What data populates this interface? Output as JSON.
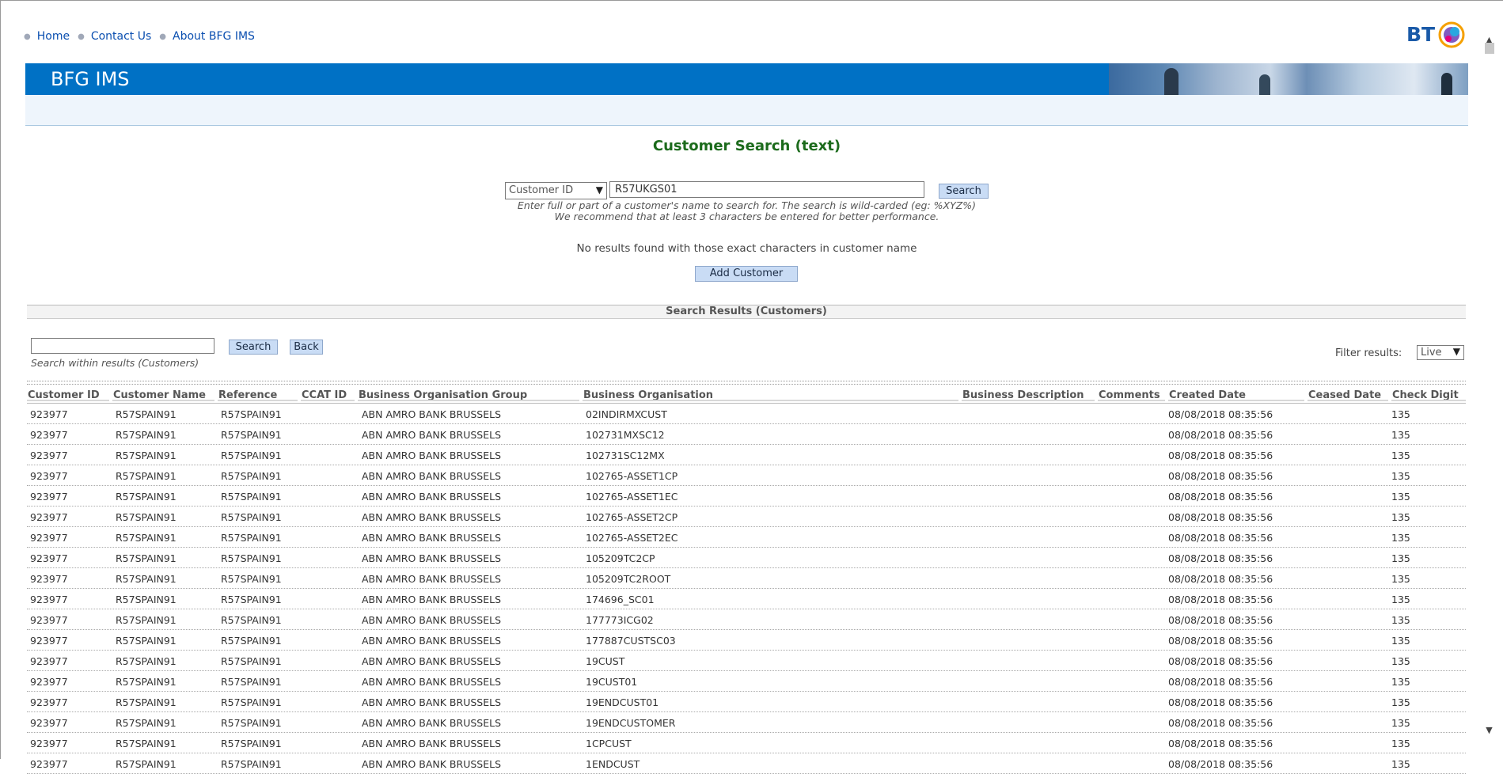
{
  "nav": {
    "home": "Home",
    "contact": "Contact Us",
    "about": "About BFG IMS"
  },
  "brand": {
    "logo_text": "BT",
    "banner_title": "BFG IMS",
    "banner_color": "#0071c5"
  },
  "page": {
    "title": "Customer Search (text)"
  },
  "search": {
    "field_type": "Customer ID",
    "value": "R57UKGS01",
    "button": "Search",
    "hint1": "Enter full or part of a customer's name to search for. The search is wild-carded (eg: %XYZ%)",
    "hint2": "We recommend that at least 3 characters be entered for better performance.",
    "no_results": "No results found with those exact characters in customer name",
    "add_button": "Add Customer"
  },
  "results": {
    "title": "Search Results (Customers)",
    "within_search_value": "",
    "within_search_button": "Search",
    "back_button": "Back",
    "within_hint": "Search within results (Customers)",
    "filter_label": "Filter results:",
    "filter_value": "Live",
    "columns": [
      "Customer ID",
      "Customer Name",
      "Reference",
      "CCAT ID",
      "Business Organisation Group",
      "Business Organisation",
      "Business Description",
      "Comments",
      "Created Date",
      "Ceased Date",
      "Check Digit"
    ],
    "rows": [
      [
        "923977",
        "R57SPAIN91",
        "R57SPAIN91",
        "",
        "ABN AMRO BANK BRUSSELS",
        "02INDIRMXCUST",
        "",
        "",
        "08/08/2018 08:35:56",
        "",
        "135"
      ],
      [
        "923977",
        "R57SPAIN91",
        "R57SPAIN91",
        "",
        "ABN AMRO BANK BRUSSELS",
        "102731MXSC12",
        "",
        "",
        "08/08/2018 08:35:56",
        "",
        "135"
      ],
      [
        "923977",
        "R57SPAIN91",
        "R57SPAIN91",
        "",
        "ABN AMRO BANK BRUSSELS",
        "102731SC12MX",
        "",
        "",
        "08/08/2018 08:35:56",
        "",
        "135"
      ],
      [
        "923977",
        "R57SPAIN91",
        "R57SPAIN91",
        "",
        "ABN AMRO BANK BRUSSELS",
        "102765-ASSET1CP",
        "",
        "",
        "08/08/2018 08:35:56",
        "",
        "135"
      ],
      [
        "923977",
        "R57SPAIN91",
        "R57SPAIN91",
        "",
        "ABN AMRO BANK BRUSSELS",
        "102765-ASSET1EC",
        "",
        "",
        "08/08/2018 08:35:56",
        "",
        "135"
      ],
      [
        "923977",
        "R57SPAIN91",
        "R57SPAIN91",
        "",
        "ABN AMRO BANK BRUSSELS",
        "102765-ASSET2CP",
        "",
        "",
        "08/08/2018 08:35:56",
        "",
        "135"
      ],
      [
        "923977",
        "R57SPAIN91",
        "R57SPAIN91",
        "",
        "ABN AMRO BANK BRUSSELS",
        "102765-ASSET2EC",
        "",
        "",
        "08/08/2018 08:35:56",
        "",
        "135"
      ],
      [
        "923977",
        "R57SPAIN91",
        "R57SPAIN91",
        "",
        "ABN AMRO BANK BRUSSELS",
        "105209TC2CP",
        "",
        "",
        "08/08/2018 08:35:56",
        "",
        "135"
      ],
      [
        "923977",
        "R57SPAIN91",
        "R57SPAIN91",
        "",
        "ABN AMRO BANK BRUSSELS",
        "105209TC2ROOT",
        "",
        "",
        "08/08/2018 08:35:56",
        "",
        "135"
      ],
      [
        "923977",
        "R57SPAIN91",
        "R57SPAIN91",
        "",
        "ABN AMRO BANK BRUSSELS",
        "174696_SC01",
        "",
        "",
        "08/08/2018 08:35:56",
        "",
        "135"
      ],
      [
        "923977",
        "R57SPAIN91",
        "R57SPAIN91",
        "",
        "ABN AMRO BANK BRUSSELS",
        "177773ICG02",
        "",
        "",
        "08/08/2018 08:35:56",
        "",
        "135"
      ],
      [
        "923977",
        "R57SPAIN91",
        "R57SPAIN91",
        "",
        "ABN AMRO BANK BRUSSELS",
        "177887CUSTSC03",
        "",
        "",
        "08/08/2018 08:35:56",
        "",
        "135"
      ],
      [
        "923977",
        "R57SPAIN91",
        "R57SPAIN91",
        "",
        "ABN AMRO BANK BRUSSELS",
        "19CUST",
        "",
        "",
        "08/08/2018 08:35:56",
        "",
        "135"
      ],
      [
        "923977",
        "R57SPAIN91",
        "R57SPAIN91",
        "",
        "ABN AMRO BANK BRUSSELS",
        "19CUST01",
        "",
        "",
        "08/08/2018 08:35:56",
        "",
        "135"
      ],
      [
        "923977",
        "R57SPAIN91",
        "R57SPAIN91",
        "",
        "ABN AMRO BANK BRUSSELS",
        "19ENDCUST01",
        "",
        "",
        "08/08/2018 08:35:56",
        "",
        "135"
      ],
      [
        "923977",
        "R57SPAIN91",
        "R57SPAIN91",
        "",
        "ABN AMRO BANK BRUSSELS",
        "19ENDCUSTOMER",
        "",
        "",
        "08/08/2018 08:35:56",
        "",
        "135"
      ],
      [
        "923977",
        "R57SPAIN91",
        "R57SPAIN91",
        "",
        "ABN AMRO BANK BRUSSELS",
        "1CPCUST",
        "",
        "",
        "08/08/2018 08:35:56",
        "",
        "135"
      ],
      [
        "923977",
        "R57SPAIN91",
        "R57SPAIN91",
        "",
        "ABN AMRO BANK BRUSSELS",
        "1ENDCUST",
        "",
        "",
        "08/08/2018 08:35:56",
        "",
        "135"
      ]
    ]
  },
  "icons": {
    "select_arrow": "chevron-down-icon",
    "scroll_up": "scroll-up-icon",
    "scroll_down": "scroll-down-icon"
  },
  "colors": {
    "title_green": "#1c6b1c",
    "link_blue": "#0b4fb0",
    "button_bg": "#c9dcf5"
  }
}
